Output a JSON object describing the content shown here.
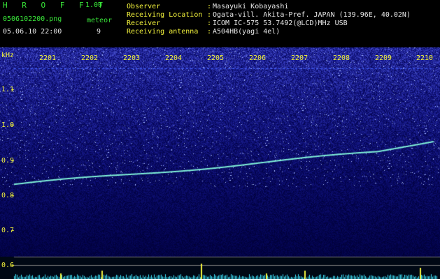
{
  "header": {
    "app_title": "H R O F F T",
    "version": "1.00",
    "filename": "0506102200.png",
    "meteor_label": "meteor",
    "meteor_count": "9",
    "datetime": "05.06.10 22:00",
    "fields": [
      {
        "label": "Observer",
        "value": "Masayuki Kobayashi"
      },
      {
        "label": "Receiving Location",
        "value": "Ogata-vill. Akita-Pref. JAPAN (139.96E, 40.02N)"
      },
      {
        "label": "Receiver",
        "value": "ICOM IC-575 53.7492(@LCD)MHz USB"
      },
      {
        "label": "Receiving antenna",
        "value": "A504HB(yagi 4el)"
      }
    ]
  },
  "spectrogram": {
    "unit": "kHz",
    "time_ticks": [
      "2201",
      "2202",
      "2203",
      "2204",
      "2205",
      "2206",
      "2207",
      "2208",
      "2209",
      "2210"
    ],
    "freq_ticks": [
      "1.1",
      "1.0",
      "0.9",
      "0.8",
      "0.7",
      "0.6"
    ],
    "colors": {
      "background": "#000000",
      "header_text": "#39e639",
      "value_text": "#e8e8e8",
      "axis_text": "#f2f23c",
      "trace": "#7ff0d8",
      "noise": "#2a3cff"
    }
  }
}
